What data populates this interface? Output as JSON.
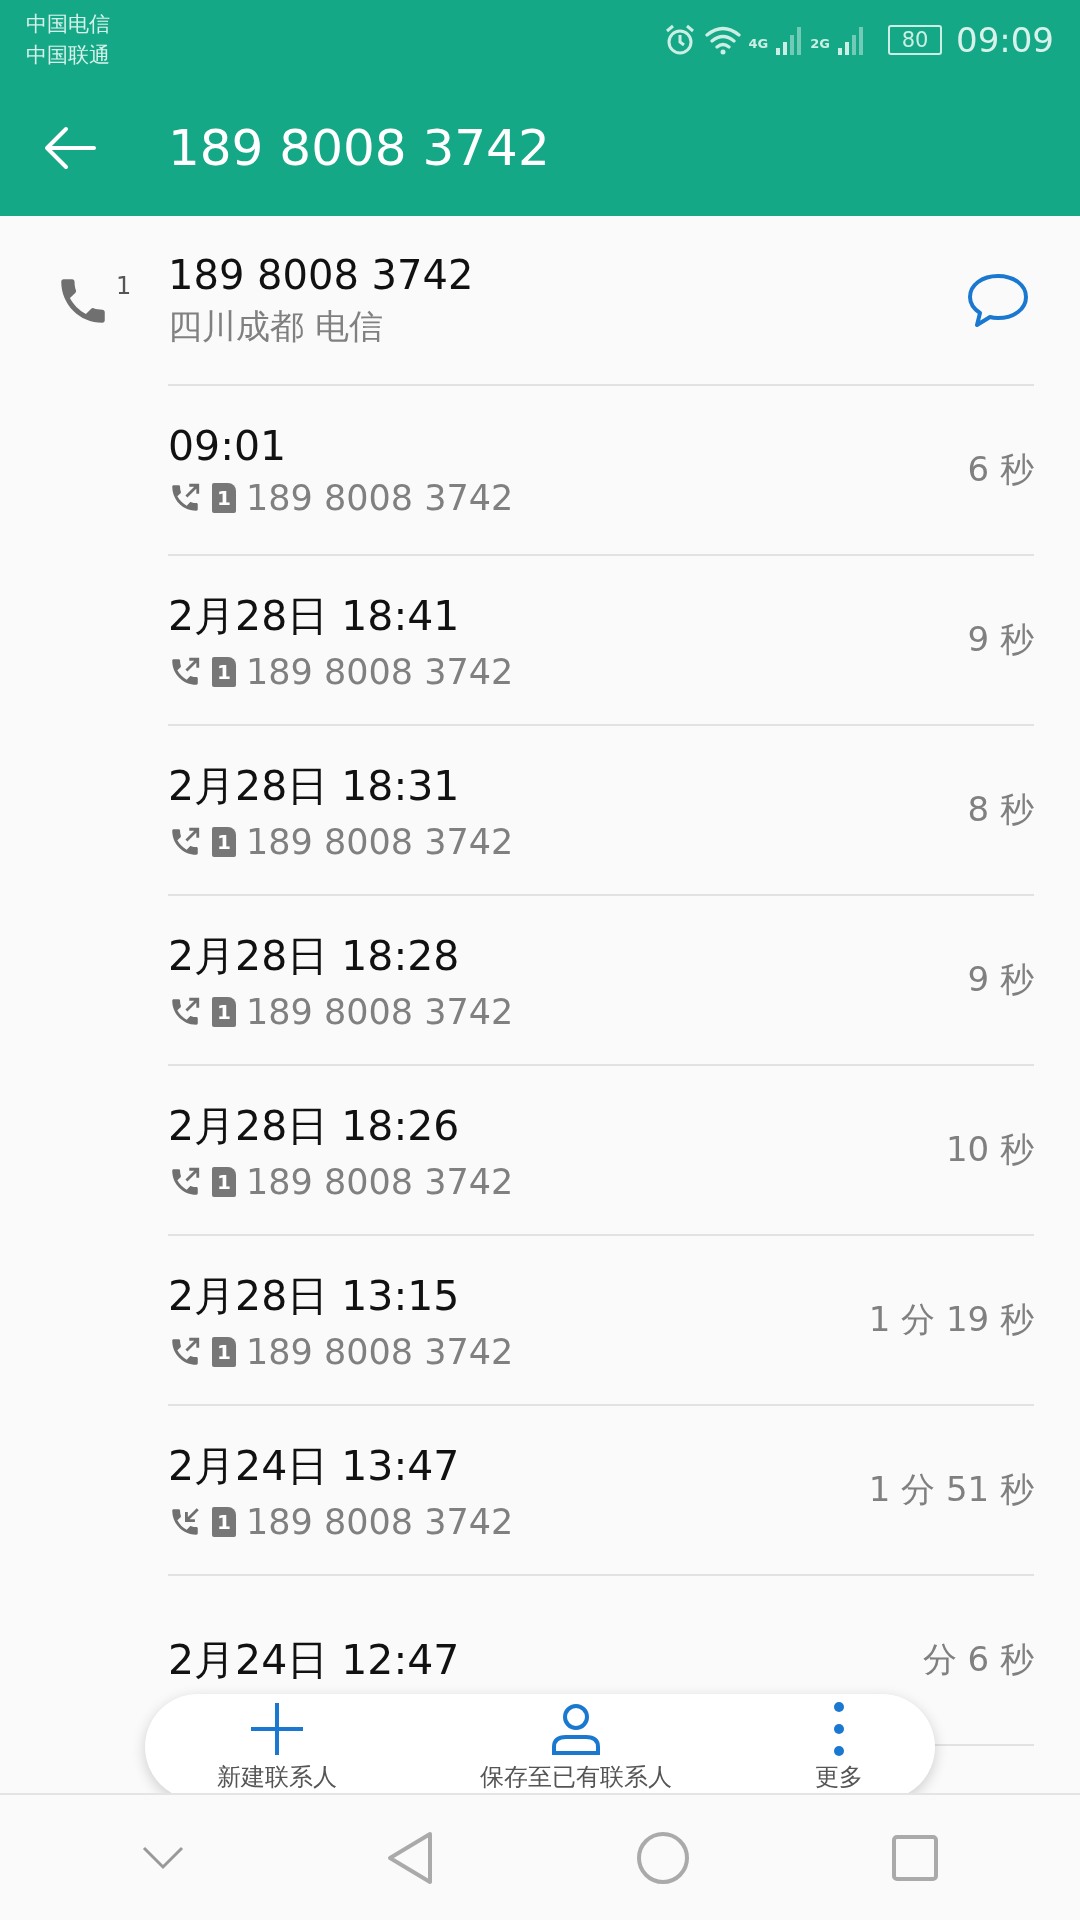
{
  "status_bar": {
    "carriers": [
      "中国电信",
      "中国联通"
    ],
    "networks": [
      "4G",
      "2G"
    ],
    "battery": "80",
    "time": "09:09"
  },
  "app_bar": {
    "title": "189 8008 3742"
  },
  "contact": {
    "number": "189 8008 3742",
    "location": "四川成都 电信",
    "call_count": "1"
  },
  "calls": [
    {
      "time": "09:01",
      "kind": "outgoing",
      "sim": "1",
      "number": "189 8008 3742",
      "duration": "6 秒"
    },
    {
      "time": "2月28日 18:41",
      "kind": "outgoing",
      "sim": "1",
      "number": "189 8008 3742",
      "duration": "9 秒"
    },
    {
      "time": "2月28日 18:31",
      "kind": "outgoing",
      "sim": "1",
      "number": "189 8008 3742",
      "duration": "8 秒"
    },
    {
      "time": "2月28日 18:28",
      "kind": "outgoing",
      "sim": "1",
      "number": "189 8008 3742",
      "duration": "9 秒"
    },
    {
      "time": "2月28日 18:26",
      "kind": "outgoing",
      "sim": "1",
      "number": "189 8008 3742",
      "duration": "10 秒"
    },
    {
      "time": "2月28日 13:15",
      "kind": "outgoing",
      "sim": "1",
      "number": "189 8008 3742",
      "duration": "1 分 19 秒"
    },
    {
      "time": "2月24日 13:47",
      "kind": "incoming",
      "sim": "1",
      "number": "189 8008 3742",
      "duration": "1 分 51 秒"
    },
    {
      "time": "2月24日 12:47",
      "kind": "hidden",
      "duration": "分 6 秒"
    }
  ],
  "actions": [
    {
      "kind": "add",
      "label": "新建联系人"
    },
    {
      "kind": "person",
      "label": "保存至已有联系人"
    },
    {
      "kind": "more",
      "label": "更多"
    }
  ]
}
